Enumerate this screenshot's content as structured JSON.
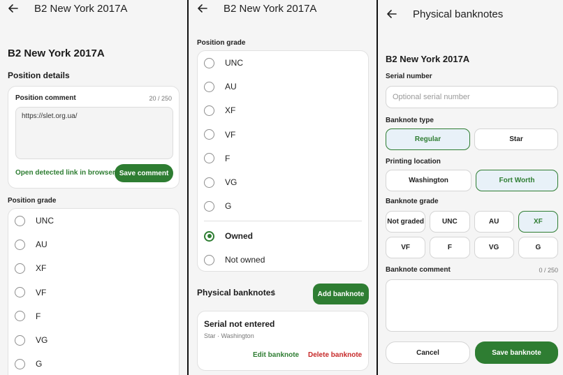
{
  "panel1": {
    "topbar_title": "B2 New York 2017A",
    "heading": "B2 New York 2017A",
    "section_title": "Position details",
    "comment_label": "Position comment",
    "comment_counter": "20 / 250",
    "comment_value": "https://slet.org.ua/",
    "open_link_label": "Open detected link in browser",
    "save_comment_label": "Save comment",
    "grade_label": "Position grade",
    "grades": [
      "UNC",
      "AU",
      "XF",
      "VF",
      "F",
      "VG",
      "G"
    ]
  },
  "panel2": {
    "topbar_title": "B2 New York 2017A",
    "grade_label": "Position grade",
    "grades": [
      "UNC",
      "AU",
      "XF",
      "VF",
      "F",
      "VG",
      "G"
    ],
    "ownership": [
      {
        "label": "Owned",
        "checked": true
      },
      {
        "label": "Not owned",
        "checked": false
      }
    ],
    "physical_title": "Physical banknotes",
    "physical_count": "1",
    "add_banknote_label": "Add banknote",
    "banknote_card": {
      "title": "Serial not entered",
      "subtitle": "Star · Washington",
      "edit_label": "Edit banknote",
      "delete_label": "Delete banknote"
    }
  },
  "panel3": {
    "topbar_title": "Physical banknotes",
    "heading": "B2 New York 2017A",
    "serial_label": "Serial number",
    "serial_placeholder": "Optional serial number",
    "type_label": "Banknote type",
    "types": [
      {
        "label": "Regular",
        "selected": true
      },
      {
        "label": "Star",
        "selected": false
      }
    ],
    "location_label": "Printing location",
    "locations": [
      {
        "label": "Washington",
        "selected": false
      },
      {
        "label": "Fort Worth",
        "selected": true
      }
    ],
    "grade_label": "Banknote grade",
    "grades_row1": [
      {
        "label": "Not graded",
        "selected": false
      },
      {
        "label": "UNC",
        "selected": false
      },
      {
        "label": "AU",
        "selected": false
      },
      {
        "label": "XF",
        "selected": true
      }
    ],
    "grades_row2": [
      {
        "label": "VF",
        "selected": false
      },
      {
        "label": "F",
        "selected": false
      },
      {
        "label": "VG",
        "selected": false
      },
      {
        "label": "G",
        "selected": false
      }
    ],
    "comment_label": "Banknote comment",
    "comment_counter": "0 / 250",
    "cancel_label": "Cancel",
    "save_label": "Save banknote"
  },
  "icons": {
    "back": "arrow-left-icon"
  },
  "colors": {
    "accent": "#2e7d32",
    "danger": "#c62828",
    "selected_bg": "#e8f1f8"
  }
}
